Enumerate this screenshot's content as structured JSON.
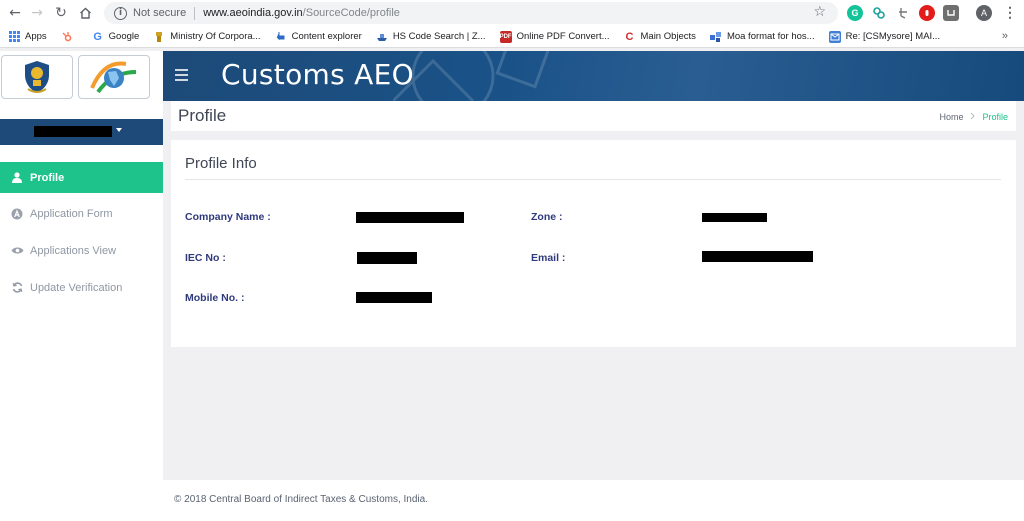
{
  "browser": {
    "url_security": "Not secure",
    "url_host": "www.aeoindia.gov.in",
    "url_path": "/SourceCode/profile",
    "bookmarks": [
      {
        "label": "Apps",
        "icon": "apps-grid-icon",
        "color": "#4285f4"
      },
      {
        "label": "",
        "icon": "hubspot-icon",
        "color": "#ff7a59"
      },
      {
        "label": "Google",
        "icon": "google-icon",
        "color": "#4285f4"
      },
      {
        "label": "Ministry Of Corpora...",
        "icon": "emblem-icon",
        "color": "#c9a227"
      },
      {
        "label": "Content explorer",
        "icon": "pointer-icon",
        "color": "#2b6bc4"
      },
      {
        "label": "HS Code Search | Z...",
        "icon": "ship-icon",
        "color": "#2b5ea7"
      },
      {
        "label": "Online PDF Convert...",
        "icon": "pdf-icon",
        "color": "#c62828"
      },
      {
        "label": "Main Objects",
        "icon": "c-icon",
        "color": "#d32f2f"
      },
      {
        "label": "Moa format for hos...",
        "icon": "blocks-icon",
        "color": "#3b6fd1"
      },
      {
        "label": "Re: [CSMysore] MAI...",
        "icon": "mail-icon",
        "color": "#3f7fd6"
      }
    ],
    "more_label": "»",
    "profile_initial": "A"
  },
  "app": {
    "title": "Customs AEO"
  },
  "sidebar": {
    "items": [
      {
        "label": "Profile",
        "icon": "user-icon",
        "active": true
      },
      {
        "label": "Application Form",
        "icon": "letter-a-circle-icon",
        "active": false
      },
      {
        "label": "Applications View",
        "icon": "eye-icon",
        "active": false
      },
      {
        "label": "Update Verification",
        "icon": "refresh-icon",
        "active": false
      }
    ]
  },
  "page": {
    "title": "Profile",
    "breadcrumb": {
      "home": "Home",
      "current": "Profile"
    }
  },
  "profile": {
    "title": "Profile Info",
    "fields": {
      "company_name": "Company Name :",
      "zone": "Zone :",
      "iec": "IEC No :",
      "email": "Email :",
      "mobile": "Mobile No. :"
    }
  },
  "footer": {
    "text": "© 2018 Central Board of Indirect Taxes & Customs, India."
  },
  "colors": {
    "primary_navy": "#1d4a78",
    "accent_green": "#1ec28b",
    "label_navy": "#2f3a7c"
  }
}
